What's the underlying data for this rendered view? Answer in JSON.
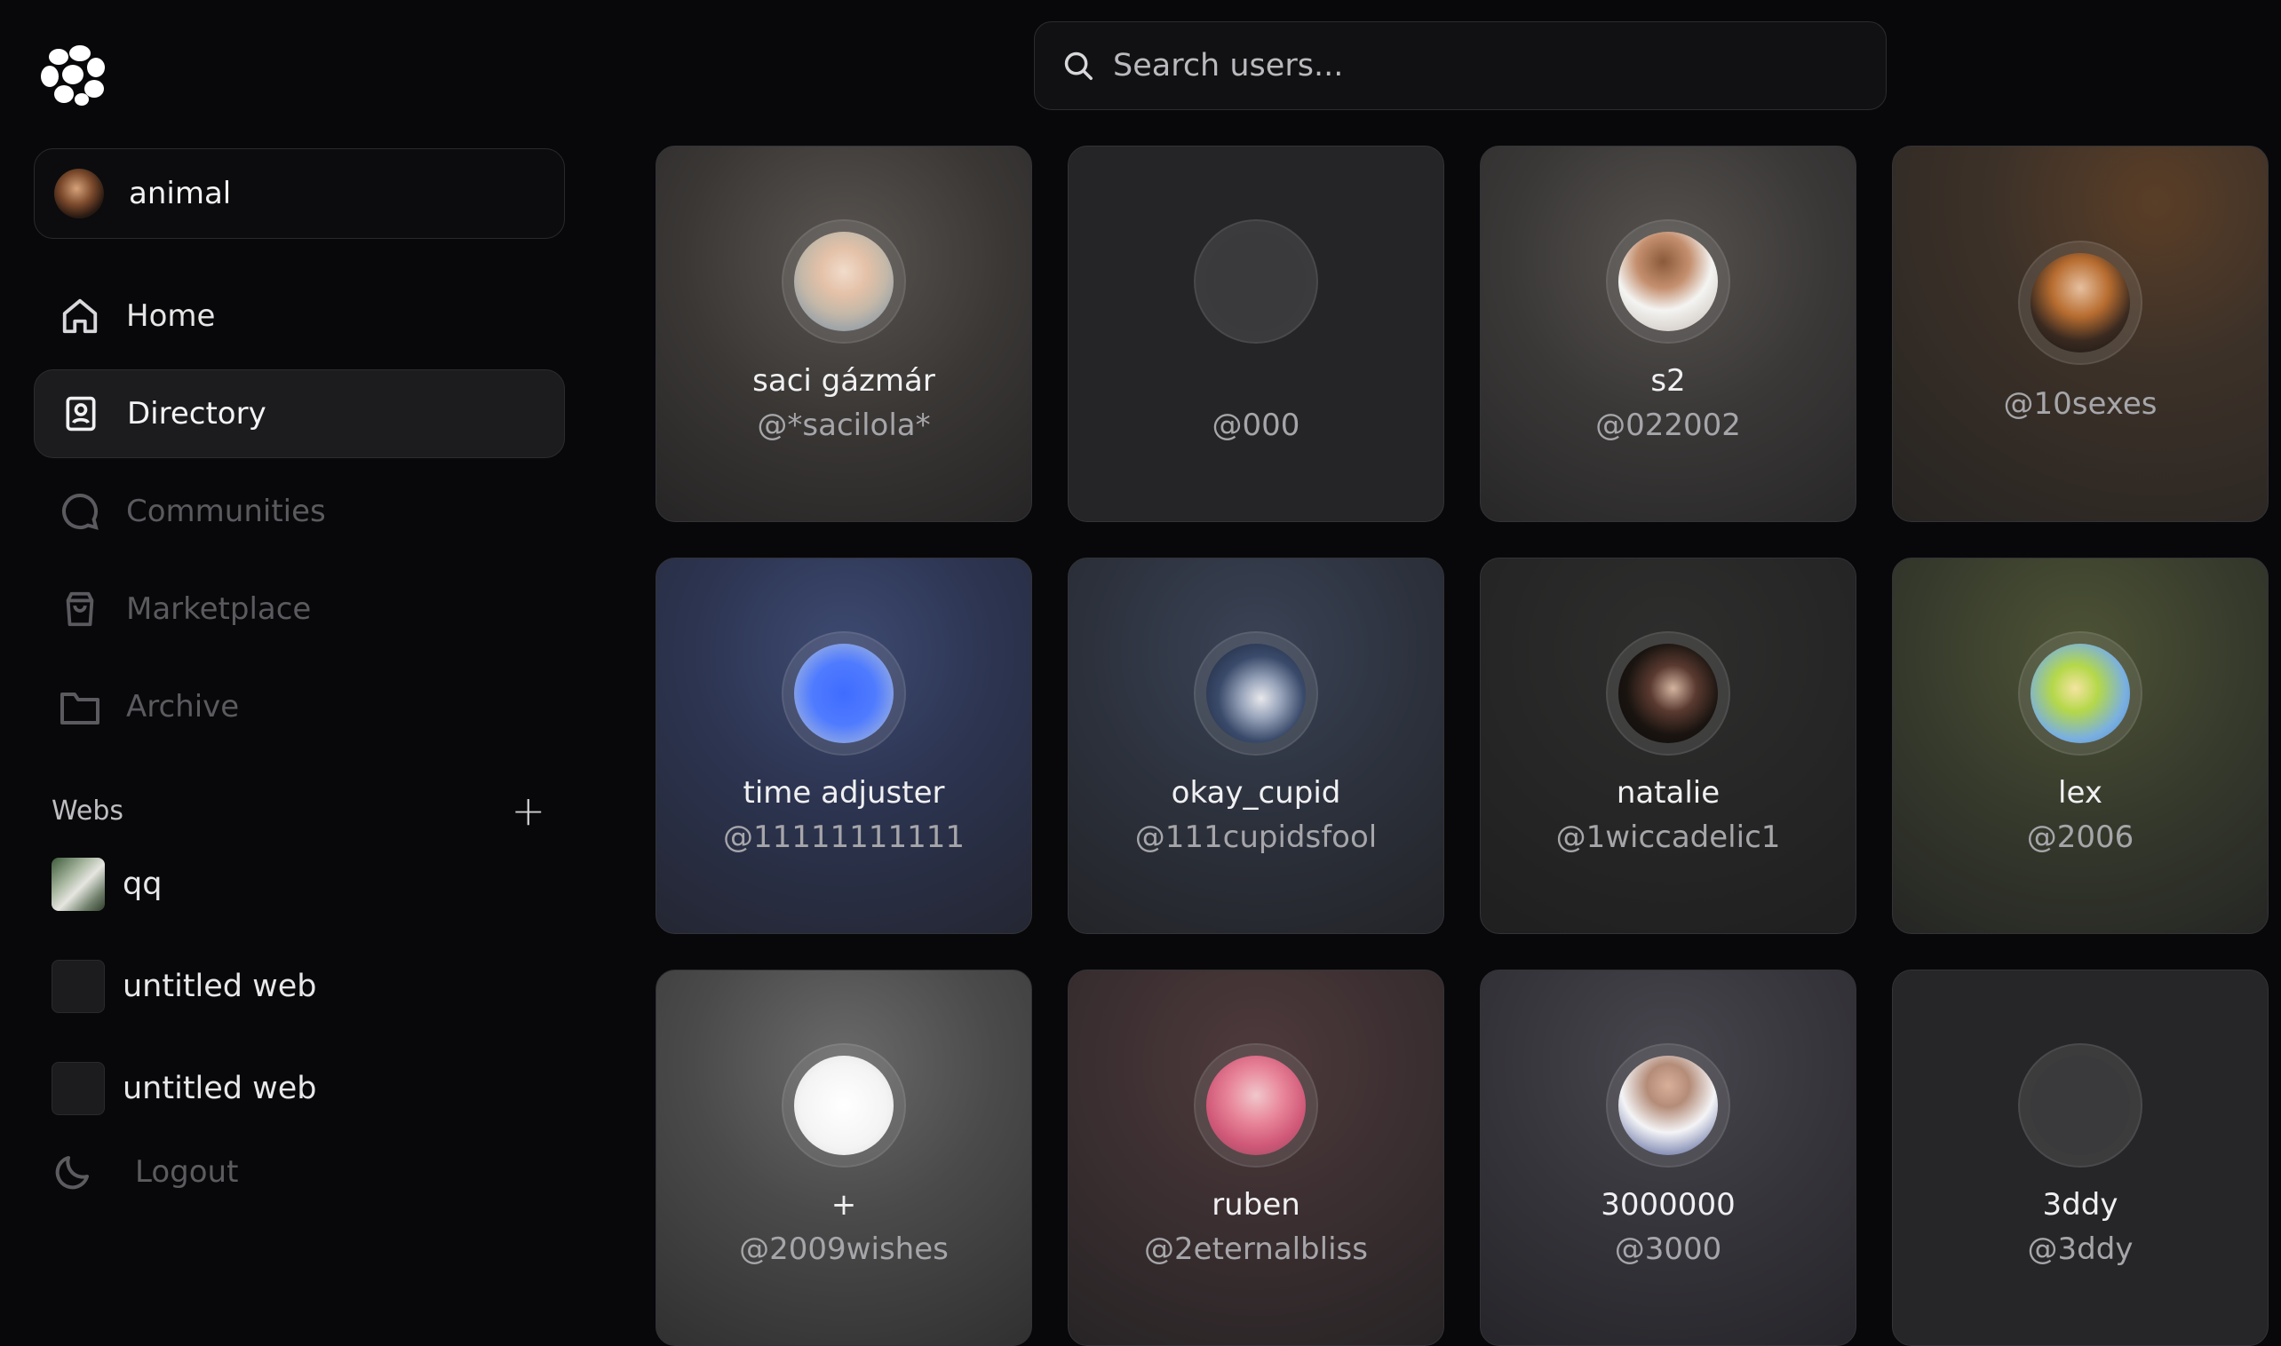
{
  "sidebar": {
    "user": {
      "name": "animal"
    },
    "nav": [
      {
        "label": "Home",
        "state": "enabled",
        "icon": "home-icon"
      },
      {
        "label": "Directory",
        "state": "active",
        "icon": "contact-book-icon"
      },
      {
        "label": "Communities",
        "state": "muted",
        "icon": "chat-bubble-icon"
      },
      {
        "label": "Marketplace",
        "state": "muted",
        "icon": "shopping-bag-icon"
      },
      {
        "label": "Archive",
        "state": "muted",
        "icon": "folder-icon"
      }
    ],
    "webs": {
      "title": "Webs",
      "add_label": "+",
      "items": [
        {
          "label": "qq"
        },
        {
          "label": "untitled web"
        },
        {
          "label": "untitled web"
        }
      ]
    },
    "logout_label": "Logout"
  },
  "search": {
    "placeholder": "Search users...",
    "value": ""
  },
  "users": [
    {
      "name": "saci gázmár",
      "handle": "@*sacilola*"
    },
    {
      "name": "",
      "handle": "@000"
    },
    {
      "name": "s2",
      "handle": "@022002"
    },
    {
      "name": "",
      "handle": "@10sexes"
    },
    {
      "name": "time adjuster",
      "handle": "@11111111111"
    },
    {
      "name": "okay_cupid",
      "handle": "@111cupidsfool"
    },
    {
      "name": "natalie",
      "handle": "@1wiccadelic1"
    },
    {
      "name": "lex",
      "handle": "@2006"
    },
    {
      "name": "+",
      "handle": "@2009wishes"
    },
    {
      "name": "ruben",
      "handle": "@2eternalbliss"
    },
    {
      "name": "3000000",
      "handle": "@3000"
    },
    {
      "name": "3ddy",
      "handle": "@3ddy"
    }
  ],
  "colors": {
    "background": "#08080a",
    "card_border": "#333338",
    "active_nav": "#1c1c1f",
    "muted_text": "#5a5a5f"
  }
}
